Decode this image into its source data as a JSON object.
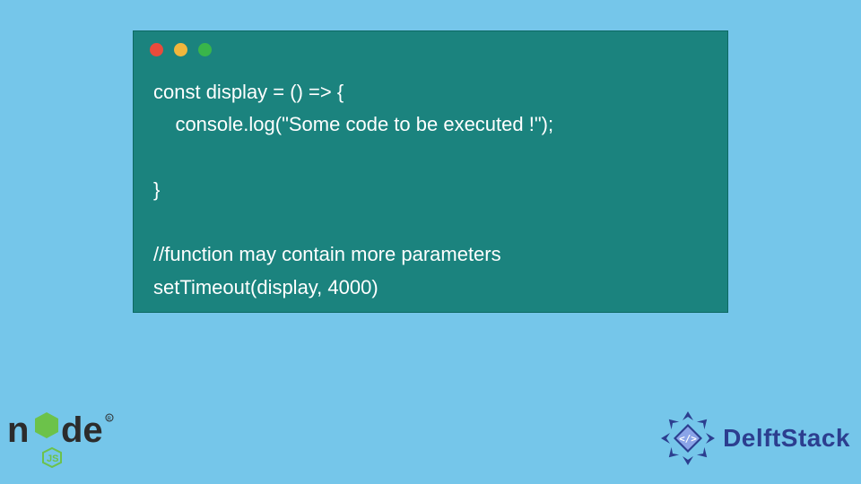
{
  "code": {
    "lines": [
      "const display = () => {",
      "    console.log(\"Some code to be executed !\");",
      "",
      "}",
      "",
      "//function may contain more parameters",
      "setTimeout(display, 4000)"
    ]
  },
  "branding": {
    "delftstack": "DelftStack",
    "nodejs": "node"
  },
  "colors": {
    "bg": "#75c6ea",
    "card": "#1b837e",
    "text": "#ffffff",
    "delft": "#2c3e8f",
    "node_dark": "#2c2c2c",
    "node_green": "#6cc24a"
  }
}
